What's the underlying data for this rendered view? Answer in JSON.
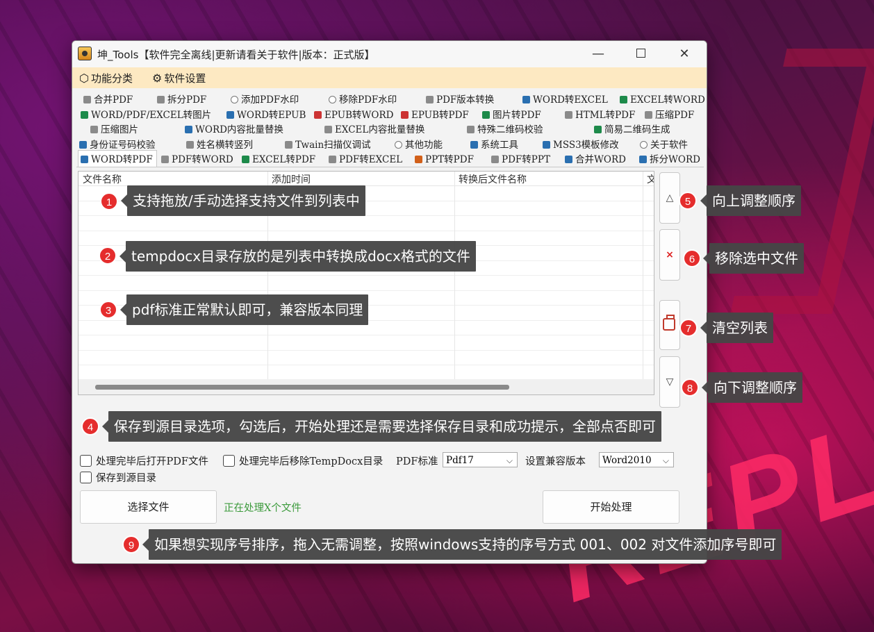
{
  "window": {
    "title": "坤_Tools【软件完全离线|更新请看关于软件|版本：正式版】"
  },
  "menu": {
    "categories": "功能分类",
    "settings": "软件设置"
  },
  "tabs": {
    "row1": [
      "合并PDF",
      "拆分PDF",
      "添加PDF水印",
      "移除PDF水印",
      "PDF版本转换",
      "WORD转EXCEL",
      "EXCEL转WORD"
    ],
    "row2": [
      "WORD/PDF/EXCEL转图片",
      "WORD转EPUB",
      "EPUB转WORD",
      "EPUB转PDF",
      "图片转PDF",
      "HTML转PDF",
      "压缩PDF"
    ],
    "row3": [
      "压缩图片",
      "WORD内容批量替换",
      "EXCEL内容批量替换",
      "特殊二维码校验",
      "简易二维码生成"
    ],
    "row4": [
      "身份证号码校验",
      "姓名横转竖列",
      "Twain扫描仪调试",
      "其他功能",
      "系统工具",
      "MSS3模板修改",
      "关于软件"
    ],
    "row5": [
      "WORD转PDF",
      "PDF转WORD",
      "EXCEL转PDF",
      "PDF转EXCEL",
      "PPT转PDF",
      "PDF转PPT",
      "合并WORD",
      "拆分WORD"
    ]
  },
  "list": {
    "columns": [
      "文件名称",
      "添加时间",
      "转换后文件名称",
      "文"
    ]
  },
  "side_buttons": {
    "up": "△",
    "remove": "×",
    "down": "▽"
  },
  "options": {
    "open_pdf": "处理完毕后打开PDF文件",
    "remove_temp": "处理完毕后移除TempDocx目录",
    "pdf_std_label": "PDF标准",
    "pdf_std_value": "Pdf17",
    "compat_label": "设置兼容版本",
    "compat_value": "Word2010",
    "save_to_source": "保存到源目录"
  },
  "buttons": {
    "select": "选择文件",
    "start": "开始处理"
  },
  "status": "正在处理X个文件",
  "annotations": [
    {
      "n": "1",
      "text": "支持拖放/手动选择支持文件到列表中"
    },
    {
      "n": "2",
      "text": "tempdocx目录存放的是列表中转换成docx格式的文件"
    },
    {
      "n": "3",
      "text": "pdf标准正常默认即可，兼容版本同理"
    },
    {
      "n": "4",
      "text": "保存到源目录选项，勾选后，开始处理还是需要选择保存目录和成功提示，全部点否即可"
    },
    {
      "n": "5",
      "text": "向上调整顺序"
    },
    {
      "n": "6",
      "text": "移除选中文件"
    },
    {
      "n": "7",
      "text": "清空列表"
    },
    {
      "n": "8",
      "text": "向下调整顺序"
    },
    {
      "n": "9",
      "text": "如果想实现序号排序，拖入无需调整，按照windows支持的序号方式 001、002 对文件添加序号即可"
    }
  ],
  "colors": {
    "accent_red": "#e52d2d",
    "menu_bg": "#fde9c2",
    "status_green": "#3b9a3b"
  }
}
